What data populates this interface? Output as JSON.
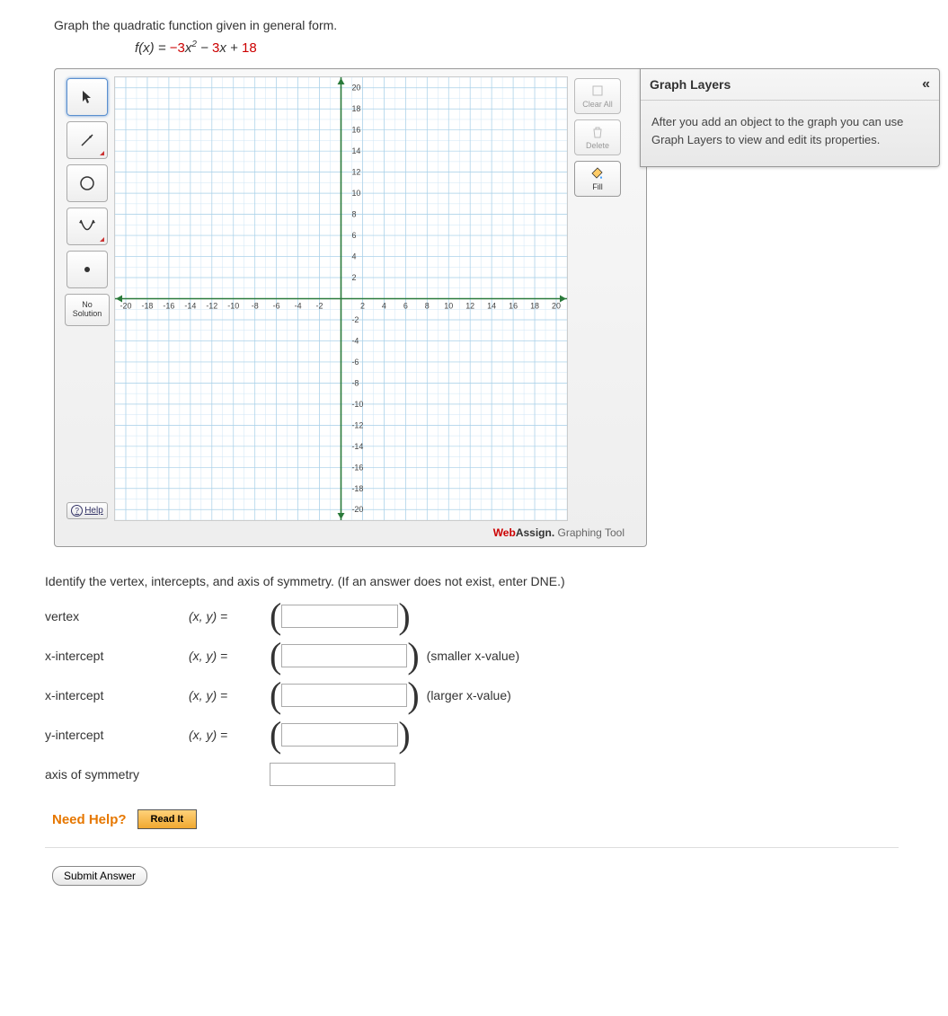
{
  "prompt": "Graph the quadratic function given in general form.",
  "equation": {
    "lhs": "f(x) = ",
    "c1": "−3",
    "x2": "x",
    "mid": " − ",
    "c2": "3",
    "x1": "x + ",
    "c3": "18"
  },
  "tools": {
    "no_solution": "No\nSolution",
    "help": "Help"
  },
  "actions": {
    "clear_all": "Clear All",
    "delete": "Delete",
    "fill": "Fill"
  },
  "chart_data": {
    "type": "empty-grid",
    "xlim": [
      -21,
      21
    ],
    "ylim": [
      -21,
      21
    ],
    "x_ticks": [
      -20,
      -18,
      -16,
      -14,
      -12,
      -10,
      -8,
      -6,
      -4,
      -2,
      2,
      4,
      6,
      8,
      10,
      12,
      14,
      16,
      18,
      20
    ],
    "y_ticks": [
      -20,
      -18,
      -16,
      -14,
      -12,
      -10,
      -8,
      -6,
      -4,
      -2,
      2,
      4,
      6,
      8,
      10,
      12,
      14,
      16,
      18,
      20
    ],
    "minor_step": 1
  },
  "footer": {
    "web": "Web",
    "assign": "Assign.",
    "rest": " Graphing Tool"
  },
  "layers": {
    "title": "Graph Layers",
    "collapse": "«",
    "body": "After you add an object to the graph you can use Graph Layers to view and edit its properties."
  },
  "q2": "Identify the vertex, intercepts, and axis of symmetry. (If an answer does not exist, enter DNE.)",
  "rows": {
    "vertex": {
      "label": "vertex",
      "xy": "(x, y)  ="
    },
    "xi1": {
      "label": "x-intercept",
      "xy": "(x, y)  =",
      "hint": "(smaller x-value)"
    },
    "xi2": {
      "label": "x-intercept",
      "xy": "(x, y)  =",
      "hint": "(larger x-value)"
    },
    "yi": {
      "label": "y-intercept",
      "xy": "(x, y)  ="
    },
    "axis": {
      "label": "axis of symmetry"
    }
  },
  "need_help": {
    "label": "Need Help?",
    "readit": "Read It"
  },
  "submit": "Submit Answer"
}
